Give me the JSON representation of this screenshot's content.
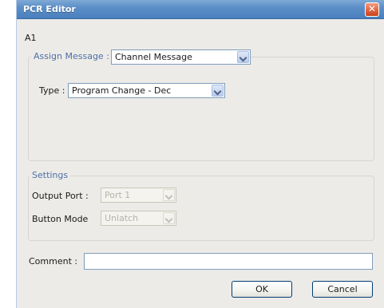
{
  "window": {
    "title": "PCR Editor",
    "close_glyph": "✕"
  },
  "item_label": "A1",
  "assign": {
    "legend": "Assign Message :",
    "message_value": "Channel Message",
    "type_label": "Type :",
    "type_value": "Program Change - Dec"
  },
  "settings": {
    "legend": "Settings",
    "output_port_label": "Output Port :",
    "output_port_value": "Port 1",
    "button_mode_label": "Button Mode",
    "button_mode_value": "Unlatch"
  },
  "comment": {
    "label": "Comment :",
    "value": ""
  },
  "buttons": {
    "ok": "OK",
    "cancel": "Cancel"
  },
  "icons": {
    "close": "close-icon",
    "dropdown": "chevron-down-icon"
  },
  "colors": {
    "titlebar": "#5c8fc8",
    "close": "#e26440",
    "window_bg": "#ecebe7",
    "group_legend": "#4f6fa8"
  }
}
